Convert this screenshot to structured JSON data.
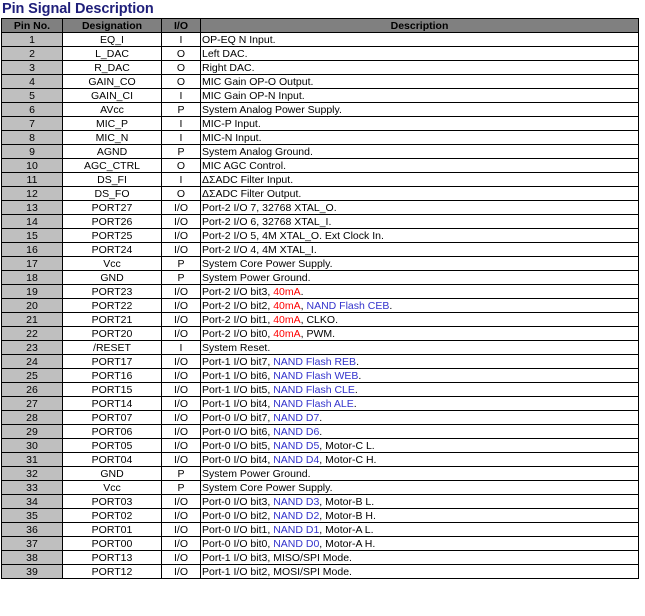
{
  "document": {
    "title": "Pin Signal Description",
    "colors": {
      "title": "#1f1f7a",
      "header_bg": "#808080",
      "header_text": "#ffffff",
      "pin_cell_bg": "#bfbfbf",
      "highlight_current": "#ff0000",
      "highlight_nand": "#3333cc"
    }
  },
  "table": {
    "columns": [
      {
        "key": "pin",
        "label": "Pin No."
      },
      {
        "key": "designation",
        "label": "Designation"
      },
      {
        "key": "io",
        "label": "I/O"
      },
      {
        "key": "description",
        "label": "Description"
      }
    ],
    "rows": [
      {
        "pin": "1",
        "designation": "EQ_I",
        "io": "I",
        "description": "OP-EQ N Input.",
        "parts": [
          {
            "t": "OP-EQ N Input.",
            "c": ""
          }
        ]
      },
      {
        "pin": "2",
        "designation": "L_DAC",
        "io": "O",
        "description": "Left DAC.",
        "parts": [
          {
            "t": "Left DAC.",
            "c": ""
          }
        ]
      },
      {
        "pin": "3",
        "designation": "R_DAC",
        "io": "O",
        "description": "Right DAC.",
        "parts": [
          {
            "t": "Right DAC.",
            "c": ""
          }
        ]
      },
      {
        "pin": "4",
        "designation": "GAIN_CO",
        "io": "O",
        "description": "MIC Gain OP-O Output.",
        "parts": [
          {
            "t": "MIC Gain OP-O Output.",
            "c": ""
          }
        ]
      },
      {
        "pin": "5",
        "designation": "GAIN_CI",
        "io": "I",
        "description": "MIC Gain OP-N Input.",
        "parts": [
          {
            "t": "MIC Gain OP-N Input.",
            "c": ""
          }
        ]
      },
      {
        "pin": "6",
        "designation": "AVcc",
        "io": "P",
        "description": "System Analog Power Supply.",
        "parts": [
          {
            "t": "System Analog Power Supply.",
            "c": ""
          }
        ]
      },
      {
        "pin": "7",
        "designation": "MIC_P",
        "io": "I",
        "description": "MIC-P Input.",
        "parts": [
          {
            "t": "MIC-P Input.",
            "c": ""
          }
        ]
      },
      {
        "pin": "8",
        "designation": "MIC_N",
        "io": "I",
        "description": "MIC-N Input.",
        "parts": [
          {
            "t": "MIC-N Input.",
            "c": ""
          }
        ]
      },
      {
        "pin": "9",
        "designation": "AGND",
        "io": "P",
        "description": "System Analog Ground.",
        "parts": [
          {
            "t": "System Analog Ground.",
            "c": ""
          }
        ]
      },
      {
        "pin": "10",
        "designation": "AGC_CTRL",
        "io": "O",
        "description": "MIC AGC Control.",
        "parts": [
          {
            "t": "MIC AGC Control.",
            "c": ""
          }
        ]
      },
      {
        "pin": "11",
        "designation": "DS_FI",
        "io": "I",
        "description": "ΔΣADC Filter Input.",
        "parts": [
          {
            "t": "ΔΣADC Filter Input.",
            "c": ""
          }
        ]
      },
      {
        "pin": "12",
        "designation": "DS_FO",
        "io": "O",
        "description": "ΔΣADC Filter Output.",
        "parts": [
          {
            "t": "ΔΣADC Filter Output.",
            "c": ""
          }
        ]
      },
      {
        "pin": "13",
        "designation": "PORT27",
        "io": "I/O",
        "description": "Port-2 I/O 7, 32768 XTAL_O.",
        "parts": [
          {
            "t": "Port-2 I/O 7, 32768 XTAL_O.",
            "c": ""
          }
        ]
      },
      {
        "pin": "14",
        "designation": "PORT26",
        "io": "I/O",
        "description": "Port-2 I/O 6, 32768 XTAL_I.",
        "parts": [
          {
            "t": "Port-2 I/O 6, 32768 XTAL_I.",
            "c": ""
          }
        ]
      },
      {
        "pin": "15",
        "designation": "PORT25",
        "io": "I/O",
        "description": "Port-2 I/O 5, 4M XTAL_O. Ext Clock In.",
        "parts": [
          {
            "t": "Port-2 I/O 5, 4M XTAL_O. Ext Clock In.",
            "c": ""
          }
        ]
      },
      {
        "pin": "16",
        "designation": "PORT24",
        "io": "I/O",
        "description": "Port-2 I/O 4, 4M XTAL_I.",
        "parts": [
          {
            "t": "Port-2 I/O 4, 4M XTAL_I.",
            "c": ""
          }
        ]
      },
      {
        "pin": "17",
        "designation": "Vcc",
        "io": "P",
        "description": "System Core Power Supply.",
        "parts": [
          {
            "t": "System Core Power Supply.",
            "c": ""
          }
        ]
      },
      {
        "pin": "18",
        "designation": "GND",
        "io": "P",
        "description": "System Power Ground.",
        "parts": [
          {
            "t": "System Power Ground.",
            "c": ""
          }
        ]
      },
      {
        "pin": "19",
        "designation": "PORT23",
        "io": "I/O",
        "description": "Port-2 I/O bit3, 40mA.",
        "parts": [
          {
            "t": "Port-2 I/O bit3, ",
            "c": ""
          },
          {
            "t": "40mA",
            "c": "red"
          },
          {
            "t": ".",
            "c": ""
          }
        ]
      },
      {
        "pin": "20",
        "designation": "PORT22",
        "io": "I/O",
        "description": "Port-2 I/O bit2, 40mA, NAND Flash CEB.",
        "parts": [
          {
            "t": "Port-2 I/O bit2, ",
            "c": ""
          },
          {
            "t": "40mA",
            "c": "red"
          },
          {
            "t": ", ",
            "c": ""
          },
          {
            "t": "NAND Flash CEB",
            "c": "blue"
          },
          {
            "t": ".",
            "c": ""
          }
        ]
      },
      {
        "pin": "21",
        "designation": "PORT21",
        "io": "I/O",
        "description": "Port-2 I/O bit1, 40mA, CLKO.",
        "parts": [
          {
            "t": "Port-2 I/O bit1, ",
            "c": ""
          },
          {
            "t": "40mA",
            "c": "red"
          },
          {
            "t": ", CLKO.",
            "c": ""
          }
        ]
      },
      {
        "pin": "22",
        "designation": "PORT20",
        "io": "I/O",
        "description": "Port-2 I/O bit0, 40mA, PWM.",
        "parts": [
          {
            "t": "Port-2 I/O bit0, ",
            "c": ""
          },
          {
            "t": "40mA",
            "c": "red"
          },
          {
            "t": ", PWM.",
            "c": ""
          }
        ]
      },
      {
        "pin": "23",
        "designation": "/RESET",
        "io": "I",
        "description": "System Reset.",
        "parts": [
          {
            "t": "System Reset.",
            "c": ""
          }
        ]
      },
      {
        "pin": "24",
        "designation": "PORT17",
        "io": "I/O",
        "description": "Port-1 I/O bit7, NAND Flash REB.",
        "parts": [
          {
            "t": "Port-1 I/O bit7, ",
            "c": ""
          },
          {
            "t": "NAND Flash REB",
            "c": "blue"
          },
          {
            "t": ".",
            "c": ""
          }
        ]
      },
      {
        "pin": "25",
        "designation": "PORT16",
        "io": "I/O",
        "description": "Port-1 I/O bit6, NAND Flash WEB.",
        "parts": [
          {
            "t": "Port-1 I/O bit6, ",
            "c": ""
          },
          {
            "t": "NAND Flash WEB",
            "c": "blue"
          },
          {
            "t": ".",
            "c": ""
          }
        ]
      },
      {
        "pin": "26",
        "designation": "PORT15",
        "io": "I/O",
        "description": "Port-1 I/O bit5, NAND Flash CLE.",
        "parts": [
          {
            "t": "Port-1 I/O bit5, ",
            "c": ""
          },
          {
            "t": "NAND Flash CLE",
            "c": "blue"
          },
          {
            "t": ".",
            "c": ""
          }
        ]
      },
      {
        "pin": "27",
        "designation": "PORT14",
        "io": "I/O",
        "description": "Port-1 I/O bit4, NAND Flash ALE.",
        "parts": [
          {
            "t": "Port-1 I/O bit4, ",
            "c": ""
          },
          {
            "t": "NAND Flash ALE",
            "c": "blue"
          },
          {
            "t": ".",
            "c": ""
          }
        ]
      },
      {
        "pin": "28",
        "designation": "PORT07",
        "io": "I/O",
        "description": "Port-0 I/O bit7, NAND D7.",
        "parts": [
          {
            "t": "Port-0 I/O bit7, ",
            "c": ""
          },
          {
            "t": "NAND D7",
            "c": "blue"
          },
          {
            "t": ".",
            "c": ""
          }
        ]
      },
      {
        "pin": "29",
        "designation": "PORT06",
        "io": "I/O",
        "description": "Port-0 I/O bit6, NAND D6.",
        "parts": [
          {
            "t": "Port-0 I/O bit6, ",
            "c": ""
          },
          {
            "t": "NAND D6",
            "c": "blue"
          },
          {
            "t": ".",
            "c": ""
          }
        ]
      },
      {
        "pin": "30",
        "designation": "PORT05",
        "io": "I/O",
        "description": "Port-0 I/O bit5, NAND D5, Motor-C L.",
        "parts": [
          {
            "t": "Port-0 I/O bit5, ",
            "c": ""
          },
          {
            "t": "NAND D5",
            "c": "blue"
          },
          {
            "t": ", Motor-C L.",
            "c": ""
          }
        ]
      },
      {
        "pin": "31",
        "designation": "PORT04",
        "io": "I/O",
        "description": "Port-0 I/O bit4, NAND D4, Motor-C H.",
        "parts": [
          {
            "t": "Port-0 I/O bit4, ",
            "c": ""
          },
          {
            "t": "NAND D4",
            "c": "blue"
          },
          {
            "t": ", Motor-C H.",
            "c": ""
          }
        ]
      },
      {
        "pin": "32",
        "designation": "GND",
        "io": "P",
        "description": "System Power Ground.",
        "parts": [
          {
            "t": "System Power Ground.",
            "c": ""
          }
        ]
      },
      {
        "pin": "33",
        "designation": "Vcc",
        "io": "P",
        "description": "System Core Power Supply.",
        "parts": [
          {
            "t": "System Core Power Supply.",
            "c": ""
          }
        ]
      },
      {
        "pin": "34",
        "designation": "PORT03",
        "io": "I/O",
        "description": "Port-0 I/O bit3, NAND D3, Motor-B L.",
        "parts": [
          {
            "t": "Port-0 I/O bit3, ",
            "c": ""
          },
          {
            "t": "NAND D3",
            "c": "blue"
          },
          {
            "t": ", Motor-B L.",
            "c": ""
          }
        ]
      },
      {
        "pin": "35",
        "designation": "PORT02",
        "io": "I/O",
        "description": "Port-0 I/O bit2, NAND D2, Motor-B H.",
        "parts": [
          {
            "t": "Port-0 I/O bit2, ",
            "c": ""
          },
          {
            "t": "NAND D2",
            "c": "blue"
          },
          {
            "t": ", Motor-B H.",
            "c": ""
          }
        ]
      },
      {
        "pin": "36",
        "designation": "PORT01",
        "io": "I/O",
        "description": "Port-0 I/O bit1, NAND D1, Motor-A L.",
        "parts": [
          {
            "t": "Port-0 I/O bit1, ",
            "c": ""
          },
          {
            "t": "NAND D1",
            "c": "blue"
          },
          {
            "t": ", Motor-A L.",
            "c": ""
          }
        ]
      },
      {
        "pin": "37",
        "designation": "PORT00",
        "io": "I/O",
        "description": "Port-0 I/O bit0, NAND D0, Motor-A H.",
        "parts": [
          {
            "t": "Port-0 I/O bit0, ",
            "c": ""
          },
          {
            "t": "NAND D0",
            "c": "blue"
          },
          {
            "t": ", Motor-A H.",
            "c": ""
          }
        ]
      },
      {
        "pin": "38",
        "designation": "PORT13",
        "io": "I/O",
        "description": "Port-1 I/O bit3, MISO/SPI Mode.",
        "parts": [
          {
            "t": "Port-1 I/O bit3, MISO/SPI Mode.",
            "c": ""
          }
        ]
      },
      {
        "pin": "39",
        "designation": "PORT12",
        "io": "I/O",
        "description": "Port-1 I/O bit2, MOSI/SPI Mode.",
        "parts": [
          {
            "t": "Port-1 I/O bit2, MOSI/SPI Mode.",
            "c": ""
          }
        ]
      }
    ]
  }
}
